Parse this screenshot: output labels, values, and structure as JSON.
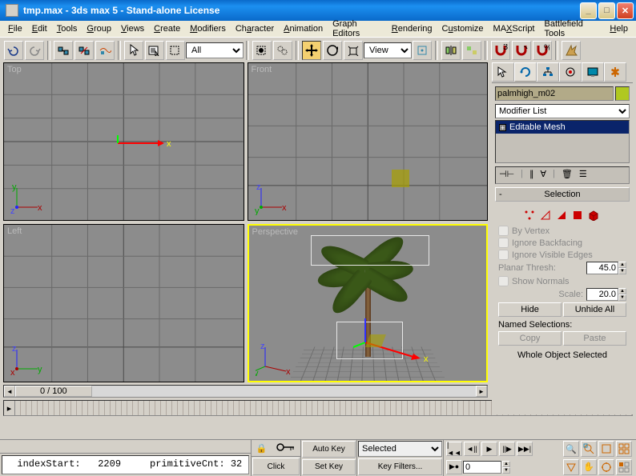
{
  "title": "tmp.max - 3ds max 5 - Stand-alone License",
  "menus": [
    "File",
    "Edit",
    "Tools",
    "Group",
    "Views",
    "Create",
    "Modifiers",
    "Character",
    "Animation",
    "Graph Editors",
    "Rendering",
    "Customize",
    "MAXScript",
    "Battlefield Tools",
    "Help"
  ],
  "toolbar": {
    "sel_filter": "All",
    "ref_sys": "View"
  },
  "viewports": {
    "tl": "Top",
    "tr": "Front",
    "bl": "Left",
    "br": "Perspective"
  },
  "timeline": {
    "label": "0 / 100"
  },
  "cmdpanel": {
    "object_name": "palmhigh_m02",
    "modifier_list_ph": "Modifier List",
    "stack_item": "Editable Mesh",
    "rollout": "Selection",
    "cb_byvertex": "By Vertex",
    "cb_ignoreback": "Ignore Backfacing",
    "cb_ignorevis": "Ignore Visible Edges",
    "planar_label": "Planar Thresh:",
    "planar_val": "45.0",
    "cb_shownorm": "Show Normals",
    "scale_label": "Scale:",
    "scale_val": "20.0",
    "hide": "Hide",
    "unhide": "Unhide All",
    "named_sel": "Named Selections:",
    "copy": "Copy",
    "paste": "Paste",
    "whole": "Whole Object Selected"
  },
  "status": {
    "text": "  indexStart:   2209     primitiveCnt: 32",
    "click": "Click ",
    "autokey": "Auto Key",
    "setkey": "Set Key",
    "selected": "Selected",
    "keyfilters": "Key Filters...",
    "frame": "0"
  }
}
